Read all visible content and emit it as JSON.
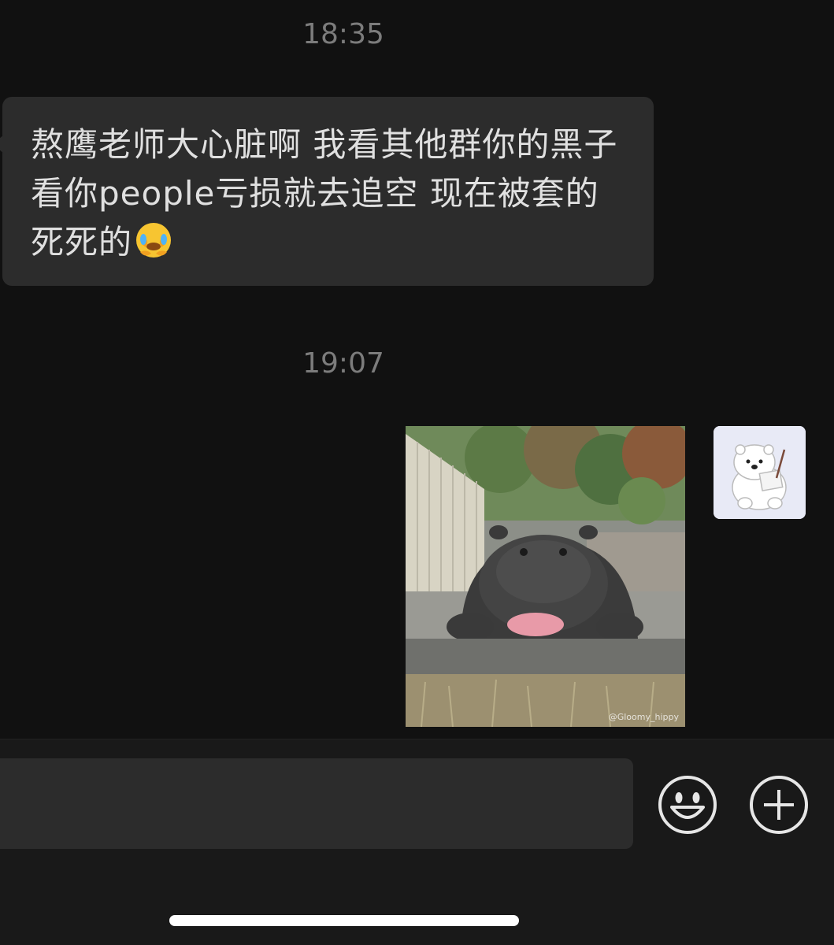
{
  "chat": {
    "timestamps": [
      "18:35",
      "19:07"
    ],
    "incoming_message": {
      "text": "熬鹰老师大心脏啊  我看其他群你的黑子 看你people亏损就去追空   现在被套的死死的",
      "emoji": "face-with-hand-over-mouth-crying-emoji"
    },
    "outgoing_image": {
      "subject": "baby-hippo-photo",
      "watermark": "@Gloomy_hippy"
    },
    "avatar": {
      "icon": "polar-bear-avatar-icon"
    }
  },
  "input_bar": {
    "emoji_button_icon": "smiley-face-icon",
    "more_button_icon": "plus-circle-icon"
  },
  "colors": {
    "background": "#111111",
    "bubble": "#2c2c2c",
    "text": "#e0e0e0",
    "timestamp": "#7c7c7c"
  }
}
